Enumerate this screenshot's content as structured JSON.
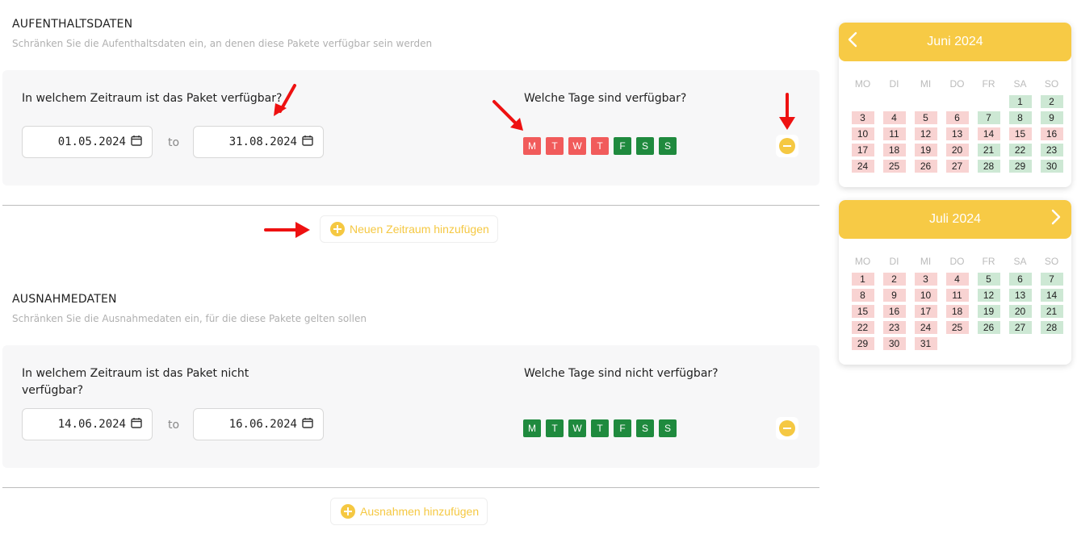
{
  "stay": {
    "title": "AUFENTHALTSDATEN",
    "subtitle": "Schränken Sie die Aufenthaltsdaten ein, an denen diese Pakete verfügbar sein werden",
    "period_question": "In welchem Zeitraum ist das Paket verfügbar?",
    "days_question": "Welche Tage sind verfügbar?",
    "from": "01.05.2024",
    "to_label": "to",
    "until": "31.08.2024",
    "days": [
      {
        "label": "M",
        "state": "red"
      },
      {
        "label": "T",
        "state": "red"
      },
      {
        "label": "W",
        "state": "red"
      },
      {
        "label": "T",
        "state": "red"
      },
      {
        "label": "F",
        "state": "green"
      },
      {
        "label": "S",
        "state": "green"
      },
      {
        "label": "S",
        "state": "green"
      }
    ],
    "add_label": "Neuen Zeitraum hinzufügen"
  },
  "exceptions": {
    "title": "AUSNAHMEDATEN",
    "subtitle": "Schränken Sie die Ausnahmedaten ein, für die diese Pakete gelten sollen",
    "period_question_line1": "In welchem Zeitraum ist das Paket nicht",
    "period_question_line2": "verfügbar?",
    "days_question": "Welche Tage sind nicht verfügbar?",
    "from": "14.06.2024",
    "to_label": "to",
    "until": "16.06.2024",
    "days": [
      {
        "label": "M",
        "state": "green"
      },
      {
        "label": "T",
        "state": "green"
      },
      {
        "label": "W",
        "state": "green"
      },
      {
        "label": "T",
        "state": "green"
      },
      {
        "label": "F",
        "state": "green"
      },
      {
        "label": "S",
        "state": "green"
      },
      {
        "label": "S",
        "state": "green"
      }
    ],
    "add_label": "Ausnahmen hinzufügen"
  },
  "calendars": [
    {
      "title": "Juni 2024",
      "weekdays": [
        "MO",
        "DI",
        "MI",
        "DO",
        "FR",
        "SA",
        "SO"
      ],
      "offset": 5,
      "days": [
        1,
        2,
        3,
        4,
        5,
        6,
        7,
        8,
        9,
        10,
        11,
        12,
        13,
        14,
        15,
        16,
        17,
        18,
        19,
        20,
        21,
        22,
        23,
        24,
        25,
        26,
        27,
        28,
        29,
        30
      ],
      "green_days": [
        1,
        2,
        7,
        8,
        9,
        21,
        22,
        23,
        28,
        29,
        30
      ],
      "white_days": []
    },
    {
      "title": "Juli 2024",
      "weekdays": [
        "MO",
        "DI",
        "MI",
        "DO",
        "FR",
        "SA",
        "SO"
      ],
      "offset": 0,
      "days": [
        1,
        2,
        3,
        4,
        5,
        6,
        7,
        8,
        9,
        10,
        11,
        12,
        13,
        14,
        15,
        16,
        17,
        18,
        19,
        20,
        21,
        22,
        23,
        24,
        25,
        26,
        27,
        28,
        29,
        30,
        31
      ],
      "green_days": [
        5,
        6,
        7,
        12,
        13,
        14,
        19,
        20,
        21,
        26,
        27,
        28
      ],
      "white_days": []
    }
  ],
  "colors": {
    "accent": "#f7ca45",
    "day_red": "#f15b5b",
    "day_green": "#1f8a3e",
    "cal_red": "#f8d3d2",
    "cal_green": "#cde8d4",
    "arrow": "#ee1111"
  }
}
